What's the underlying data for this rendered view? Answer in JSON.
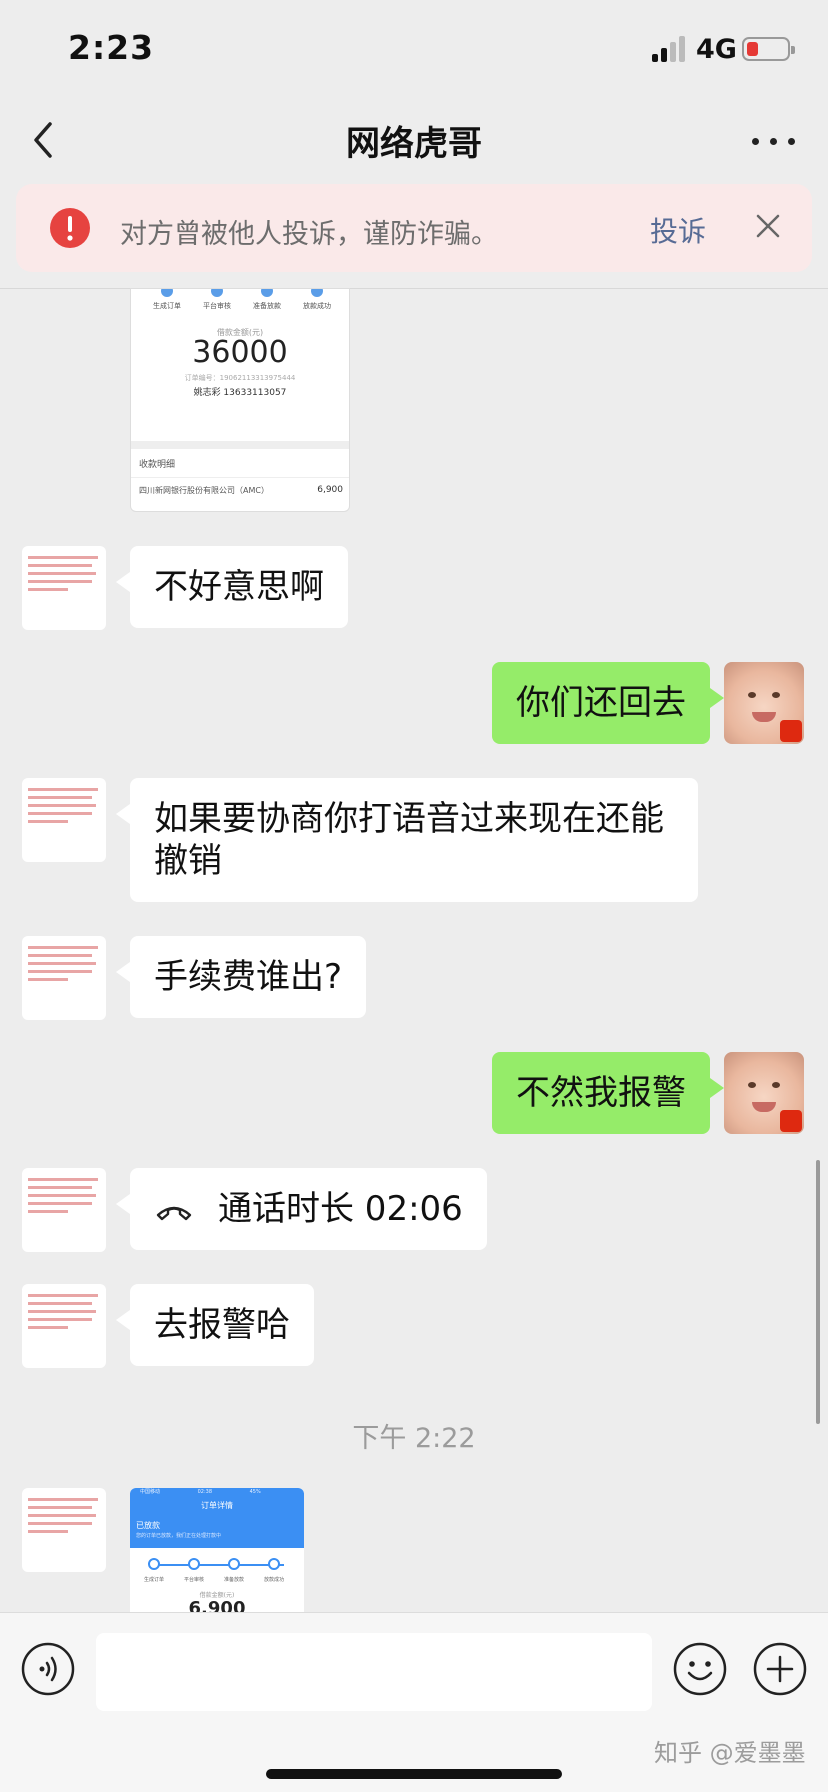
{
  "status_bar": {
    "time": "2:23",
    "network": "4G",
    "battery_color": "#e53935"
  },
  "nav": {
    "title": "网络虎哥"
  },
  "warning": {
    "text": "对方曾被他人投诉，谨防诈骗。",
    "action_label": "投诉",
    "icon_color": "#e64340"
  },
  "receipt_image": {
    "steps": [
      "生成订单",
      "平台审核",
      "准备放款",
      "放款成功"
    ],
    "amount_label": "借款金额(元)",
    "amount": "36000",
    "order_no": "订单编号：19062113313975444",
    "payee": "姚志彩 13633113057",
    "detail_title": "收款明细",
    "detail_bank": "四川新网银行股份有限公司（AMC）",
    "detail_amount": "6,900"
  },
  "messages": [
    {
      "text": "不好意思啊"
    },
    {
      "text": "你们还回去"
    },
    {
      "text": "如果要协商你打语音过来现在还能撤销"
    },
    {
      "text": "手续费谁出?"
    },
    {
      "text": "不然我报警"
    },
    {
      "text": "通话时长 02:06"
    },
    {
      "text": "去报警哈"
    }
  ],
  "timestamp": "下午 2:22",
  "order_image": {
    "carrier": "中国移动",
    "time": "02:38",
    "battery": "45%",
    "title": "订单详情",
    "state": "已放款",
    "subtitle": "您的订单已放款，我们正在处理打款中",
    "steps": [
      "生成订单",
      "平台审核",
      "准备放款",
      "放款成功"
    ],
    "amount_label": "借款金额(元)",
    "amount": "6,900"
  },
  "input_bar": {
    "placeholder": ""
  },
  "watermark": "知乎 @爱墨墨"
}
